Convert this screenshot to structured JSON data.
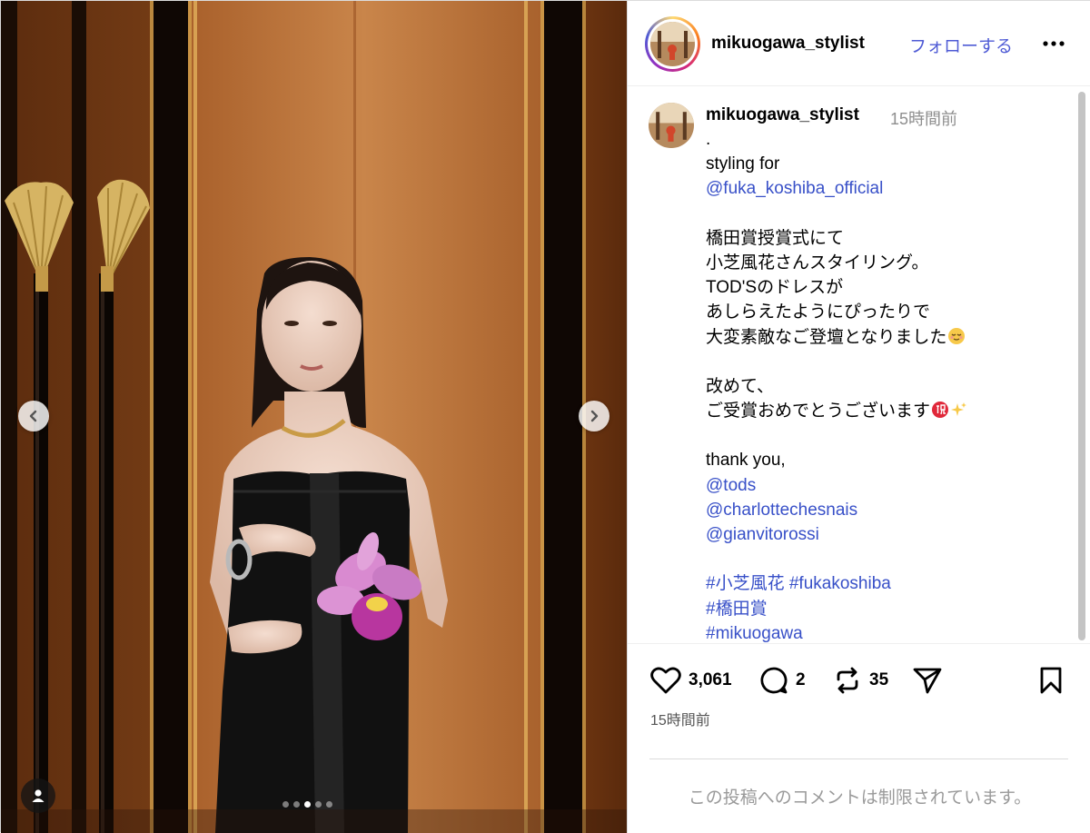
{
  "header": {
    "username": "mikuogawa_stylist",
    "follow_label": "フォローする",
    "more_icon": "more-horizontal-icon"
  },
  "carousel": {
    "total_slides": 5,
    "active_slide": 3,
    "prev_icon": "chevron-left-icon",
    "next_icon": "chevron-right-icon",
    "tag_icon": "person-tag-icon"
  },
  "caption": {
    "username": "mikuogawa_stylist",
    "time": "15時間前",
    "lines": {
      "l0": ".",
      "l1": "styling for",
      "l2": "@fuka_koshiba_official",
      "l3": "",
      "l4": "橋田賞授賞式にて",
      "l5": "小芝風花さんスタイリング。",
      "l6": "TOD'Sのドレスが",
      "l7": "あしらえたようにぴったりで",
      "l8": "大変素敵なご登壇となりました",
      "l9": "",
      "l10": "改めて、",
      "l11": "ご受賞おめでとうございます",
      "l12": "",
      "l13": "thank you,",
      "l14": "@tods",
      "l15": "@charlottechesnais",
      "l16": "@gianvitorossi",
      "l17": "",
      "l18a": "#小芝風花",
      "l18b": "#fukakoshiba",
      "l19": "#橋田賞",
      "l20": "#mikuogawa"
    },
    "emoji": {
      "relieved": "relieved-face-emoji",
      "congratulations": "congratulations-kanji-emoji",
      "sparkles": "sparkles-emoji"
    }
  },
  "actions": {
    "likes": "3,061",
    "comments": "2",
    "reposts": "35",
    "time": "15時間前",
    "icons": [
      "heart-icon",
      "comment-icon",
      "repost-icon",
      "share-icon",
      "bookmark-icon"
    ]
  },
  "comment_notice": "この投稿へのコメントは制限されています。",
  "colors": {
    "link": "#3850c8",
    "follow": "#4f5bd5",
    "secondary_text": "#8e8e8e",
    "border": "#dbdbdb"
  }
}
